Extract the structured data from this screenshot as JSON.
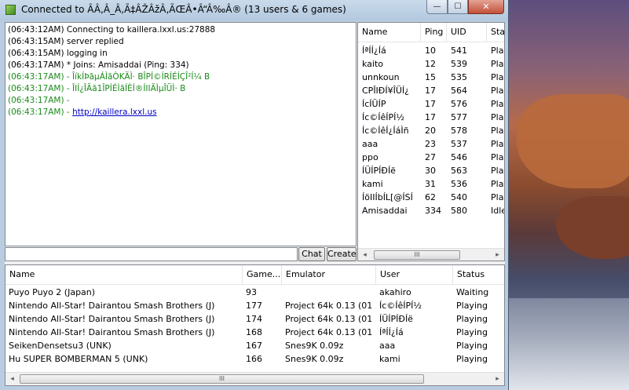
{
  "window": {
    "title": "Connected to ÂÂ‚Â_Â‚Ã‡ÂŽÂžÂ‚ÃŒÂ•Â“Â‰Â® (13 users & 6 games)",
    "min_glyph": "—",
    "max_glyph": "☐",
    "close_glyph": "✕"
  },
  "chat": {
    "lines": [
      {
        "text": "(06:43:12AM) Connecting to kaillera.lxxl.us:27888",
        "color": "#000000"
      },
      {
        "text": "(06:43:15AM) server replied",
        "color": "#000000"
      },
      {
        "text": "(06:43:15AM) logging in",
        "color": "#000000"
      },
      {
        "text": "(06:43:17AM) * Joins: Amisaddai (Ping: 334)",
        "color": "#000000"
      },
      {
        "text": "(06:43:17AM) - ÎíkÍÞãµÁÌãÒKÄÌ· BÎPÍ©ÍRÍÉÍÇÎ²Í¼ B",
        "color": "#1a8a1a"
      },
      {
        "text": "(06:43:17AM) - ÎIÍ¿ÎÃã1ÎPÍÉÌãÍÈÍ®ÍIIÄÌµÎÜÌ· B",
        "color": "#1a8a1a"
      },
      {
        "text": "(06:43:17AM) -",
        "color": "#1a8a1a"
      },
      {
        "text": "(06:43:17AM) - ",
        "color": "#1a8a1a",
        "link": "http://kaillera.lxxl.us"
      }
    ],
    "chat_button": "Chat",
    "create_button": "Create",
    "input_value": ""
  },
  "users": {
    "columns": [
      "Name",
      "Ping",
      "UID",
      "Stat"
    ],
    "rows": [
      [
        "ÍªÍÍ¿Íá",
        "10",
        "541",
        "Play"
      ],
      [
        "kaito",
        "12",
        "539",
        "Play"
      ],
      [
        "unnkoun",
        "15",
        "535",
        "Play"
      ],
      [
        "CPÎIÐÍ¥ÎÜÍ¿",
        "17",
        "564",
        "Play"
      ],
      [
        "ÍcÍÜÍP",
        "17",
        "576",
        "Play"
      ],
      [
        "Íc©ÍêÍPÍ½",
        "17",
        "577",
        "Play"
      ],
      [
        "Íc©ÍêÍ¿ÍáÌñ",
        "20",
        "578",
        "Play"
      ],
      [
        "aaa",
        "23",
        "537",
        "Play"
      ],
      [
        "ppo",
        "27",
        "546",
        "Play"
      ],
      [
        "ÍÜÍPÍÐÍë",
        "30",
        "563",
        "Play"
      ],
      [
        "kami",
        "31",
        "536",
        "Play"
      ],
      [
        "ÍöIIÍbÍL[@ÍSÍ",
        "62",
        "540",
        "Play"
      ],
      [
        "Amisaddai",
        "334",
        "580",
        "Idle"
      ]
    ]
  },
  "games": {
    "columns": [
      "Name",
      "Game...",
      "Emulator",
      "User",
      "Status"
    ],
    "rows": [
      [
        "Puyo Puyo 2 (Japan)",
        "93",
        "",
        "akahiro",
        "Waiting"
      ],
      [
        "Nintendo All-Star! Dairantou Smash Brothers (J)",
        "177",
        "Project 64k 0.13 (01 ...",
        "Íc©ÍêÍPÍ½",
        "Playing"
      ],
      [
        "Nintendo All-Star! Dairantou Smash Brothers (J)",
        "174",
        "Project 64k 0.13 (01 ...",
        "ÍÜÍPÍÐÍë",
        "Playing"
      ],
      [
        "Nintendo All-Star! Dairantou Smash Brothers (J)",
        "168",
        "Project 64k 0.13 (01 ...",
        "ÍªÍÍ¿Íá",
        "Playing"
      ],
      [
        "SeikenDensetsu3      (UNK)",
        "167",
        "Snes9K 0.09z",
        "aaa",
        "Playing"
      ],
      [
        "Hu SUPER BOMBERMAN 5  (UNK)",
        "166",
        "Snes9K 0.09z",
        "kami",
        "Playing"
      ]
    ]
  },
  "scroll": {
    "left_arrow": "◂",
    "right_arrow": "▸",
    "grip": "III"
  }
}
